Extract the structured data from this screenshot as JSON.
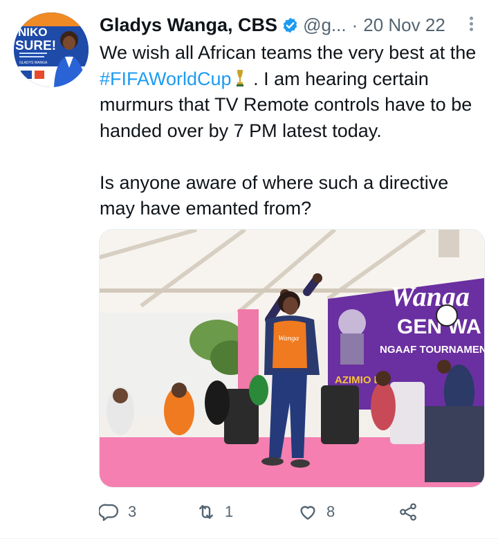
{
  "tweet": {
    "author_name": "Gladys Wanga, CBS",
    "handle": "@g...",
    "separator": "·",
    "date": "20 Nov 22",
    "text_before_hashtag": "We wish all African teams the very best at the ",
    "hashtag": "#FIFAWorldCup",
    "text_after_hashtag": " . I am hearing certain murmurs that TV Remote controls have to be handed over by 7 PM latest today.",
    "paragraph_2": "Is anyone aware of where such a directive may have emanted from?"
  },
  "avatar": {
    "poster_text_top": "NIKO",
    "poster_text_bottom": "SURE!",
    "poster_name": "GLADYS WANGA"
  },
  "media": {
    "banner_line_1": "Wanga",
    "banner_line_2": "GEN  WA",
    "banner_line_3": "NGAAF TOURNAMEN",
    "banner_line_4": "AZIMIO LA",
    "shirt_text": "Wanga"
  },
  "actions": {
    "reply_count": "3",
    "retweet_count": "1",
    "like_count": "8"
  },
  "colors": {
    "text": "#0f1419",
    "secondary": "#536471",
    "link": "#1d9bf0",
    "verified": "#1d9bf0"
  },
  "icons": [
    "verified-badge-icon",
    "more-icon",
    "trophy-icon",
    "reply-icon",
    "retweet-icon",
    "like-icon",
    "share-icon"
  ]
}
